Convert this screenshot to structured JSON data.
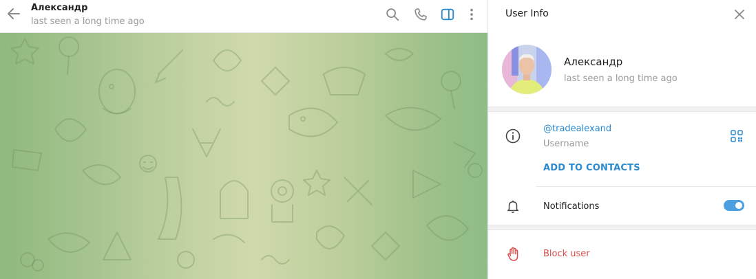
{
  "chat_header": {
    "peer_name": "Александр",
    "peer_status": "last seen a long time ago"
  },
  "icons": {
    "back": "arrow-left-icon",
    "search": "search-icon",
    "call": "phone-icon",
    "sidebar": "sidebar-toggle-icon",
    "more": "more-vertical-icon",
    "close": "close-icon",
    "info": "info-icon",
    "qr": "qr-code-icon",
    "notifications": "bell-icon",
    "block": "hand-stop-icon"
  },
  "info_panel": {
    "title": "User Info",
    "name": "Александр",
    "status": "last seen a long time ago",
    "username": "@tradealexand",
    "username_label": "Username",
    "add_contacts": "ADD TO CONTACTS",
    "notifications_label": "Notifications",
    "notifications_on": true,
    "block_label": "Block user"
  },
  "colors": {
    "accent": "#2a8acf",
    "toggle": "#4ca0df",
    "danger": "#d84d4d",
    "muted": "#999999"
  }
}
